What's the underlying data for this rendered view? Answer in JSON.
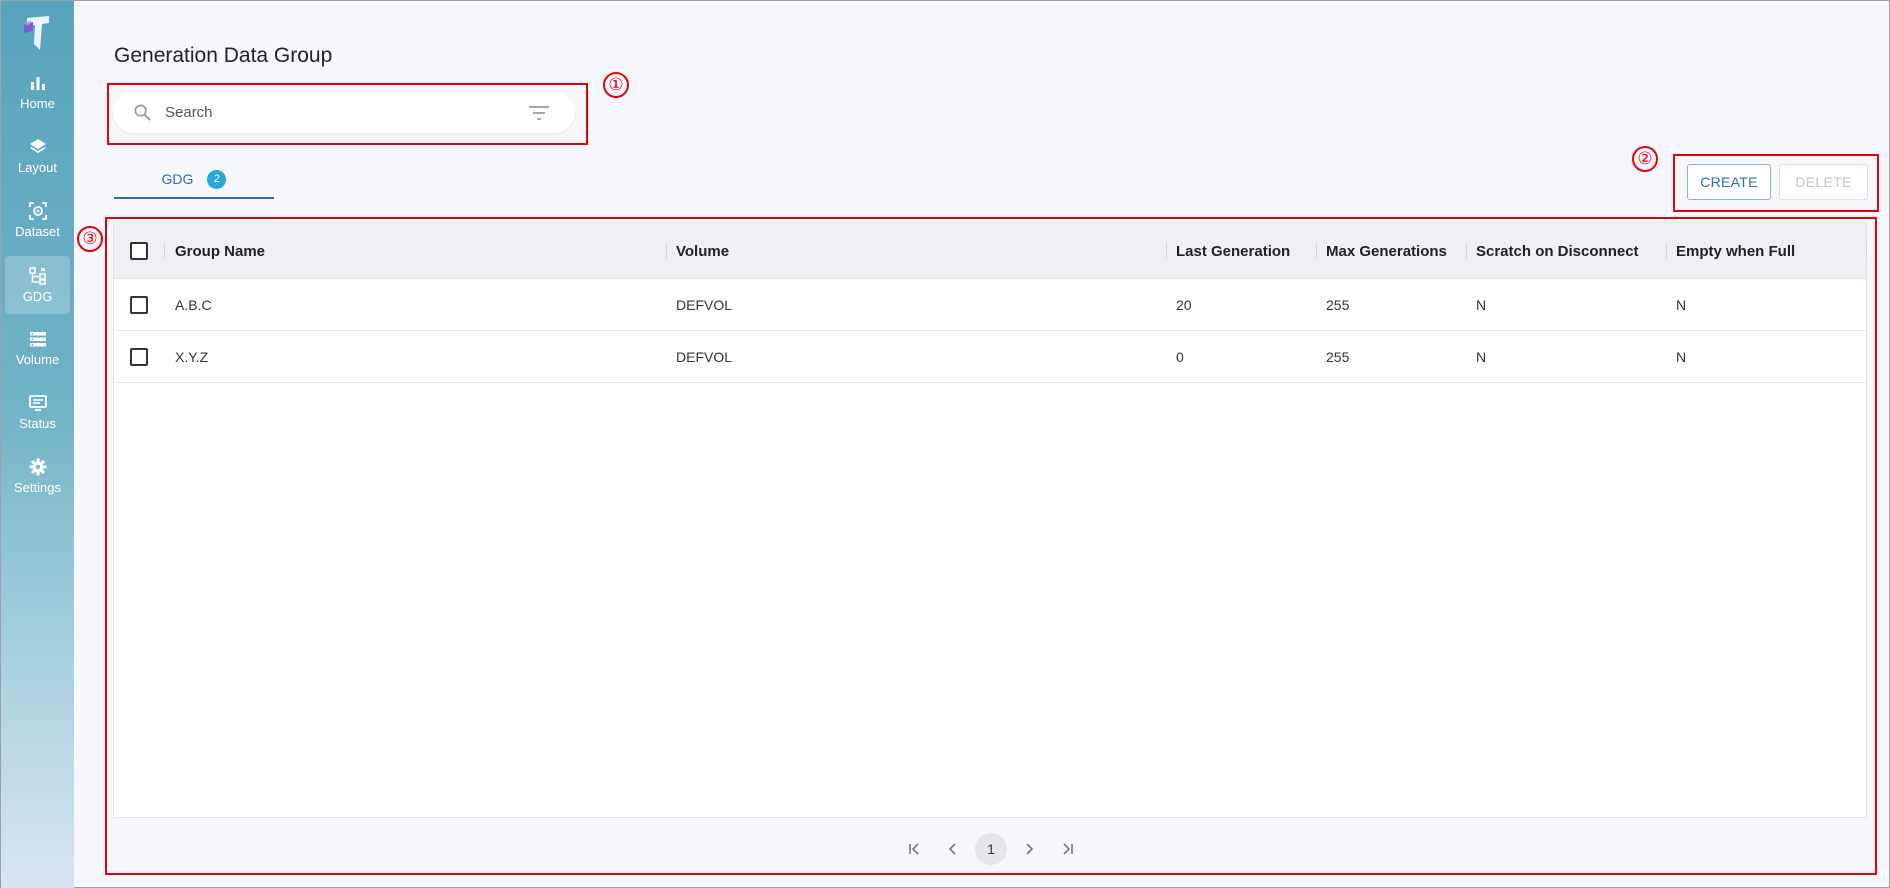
{
  "app": {
    "title": "Generation Data Group"
  },
  "sidebar": {
    "items": [
      {
        "label": "Home",
        "icon": "bar-chart-icon"
      },
      {
        "label": "Layout",
        "icon": "layers-icon"
      },
      {
        "label": "Dataset",
        "icon": "dataset-icon"
      },
      {
        "label": "GDG",
        "icon": "gdg-icon",
        "active": true
      },
      {
        "label": "Volume",
        "icon": "storage-icon"
      },
      {
        "label": "Status",
        "icon": "monitor-icon"
      },
      {
        "label": "Settings",
        "icon": "gear-icon"
      }
    ]
  },
  "search": {
    "placeholder": "Search",
    "value": ""
  },
  "tabs": [
    {
      "label": "GDG",
      "count": "2"
    }
  ],
  "toolbar": {
    "create_label": "CREATE",
    "delete_label": "DELETE"
  },
  "table": {
    "columns": [
      "Group Name",
      "Volume",
      "Last Generation",
      "Max Generations",
      "Scratch on Disconnect",
      "Empty when Full"
    ],
    "rows": [
      [
        "A.B.C",
        "DEFVOL",
        "20",
        "255",
        "N",
        "N"
      ],
      [
        "X.Y.Z",
        "DEFVOL",
        "0",
        "255",
        "N",
        "N"
      ]
    ]
  },
  "pagination": {
    "current_page": "1"
  },
  "annotations": [
    "①",
    "②",
    "③"
  ],
  "colors": {
    "accent": "#2f6fa8",
    "badge": "#2aa7df",
    "annotation": "#e0000f"
  }
}
